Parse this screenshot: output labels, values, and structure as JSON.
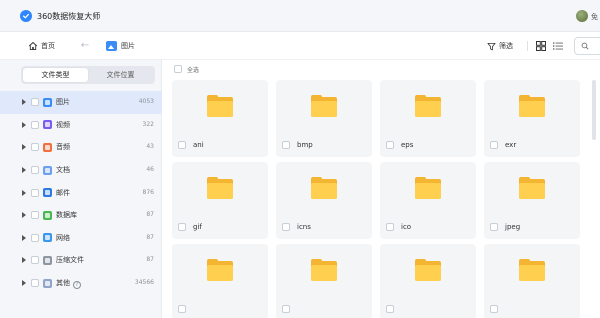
{
  "app": {
    "title": "360数据恢复大师",
    "user_name": "免"
  },
  "toolbar": {
    "home_label": "首页",
    "back_arrow": "←",
    "breadcrumb_label": "图片",
    "filter_label": "筛选"
  },
  "sidebar": {
    "tabs": [
      {
        "label": "文件类型",
        "active": true
      },
      {
        "label": "文件位置",
        "active": false
      }
    ],
    "categories": [
      {
        "label": "图片",
        "count": "4053",
        "icon": "image-icon",
        "color": "#3a8cf6",
        "selected": true
      },
      {
        "label": "视频",
        "count": "322",
        "icon": "video-icon",
        "color": "#7b5cf0"
      },
      {
        "label": "音频",
        "count": "43",
        "icon": "audio-icon",
        "color": "#f2703d"
      },
      {
        "label": "文档",
        "count": "46",
        "icon": "document-icon",
        "color": "#6e9ef0"
      },
      {
        "label": "邮件",
        "count": "876",
        "icon": "mail-icon",
        "color": "#2d7be0"
      },
      {
        "label": "数据库",
        "count": "87",
        "icon": "database-icon",
        "color": "#49b84f"
      },
      {
        "label": "网络",
        "count": "87",
        "icon": "network-icon",
        "color": "#3b97ee"
      },
      {
        "label": "压缩文件",
        "count": "87",
        "icon": "archive-icon",
        "color": "#8e96a3"
      },
      {
        "label": "其他",
        "count": "34566",
        "icon": "folder-icon",
        "color": "#8fa5c9",
        "help": "?"
      }
    ]
  },
  "main": {
    "select_all_label": "全选",
    "files": [
      {
        "name": "ani"
      },
      {
        "name": "bmp"
      },
      {
        "name": "eps"
      },
      {
        "name": "exr"
      },
      {
        "name": "gif"
      },
      {
        "name": "icns"
      },
      {
        "name": "ico"
      },
      {
        "name": "jpeg"
      },
      {
        "name": ""
      },
      {
        "name": ""
      },
      {
        "name": ""
      },
      {
        "name": ""
      }
    ]
  },
  "colors": {
    "accent": "#2e86ff",
    "folder": "#ffcf4f",
    "selected_row": "#dfe9fb"
  }
}
